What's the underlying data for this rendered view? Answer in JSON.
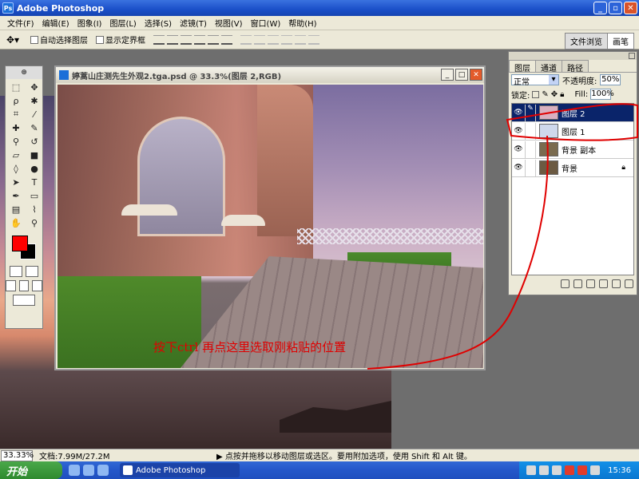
{
  "app": {
    "title": "Adobe Photoshop"
  },
  "menu": [
    "文件(F)",
    "编辑(E)",
    "图象(I)",
    "图层(L)",
    "选择(S)",
    "滤镜(T)",
    "视图(V)",
    "窗口(W)",
    "帮助(H)"
  ],
  "options": {
    "auto_select": "自动选择图层",
    "show_bounds": "显示定界框",
    "tab_file_browser": "文件浏览",
    "tab_brushes": "画笔"
  },
  "document": {
    "title": "婷蒿山庄测先生外观2.tga.psd @ 33.3%(图层 2,RGB)",
    "annotation": "按下ctrl 再点这里选取刚粘贴的位置"
  },
  "layers_panel": {
    "tabs": [
      "图层",
      "通道",
      "路径"
    ],
    "blend_mode": "正常",
    "opacity_label": "不透明度:",
    "opacity_value": "50%",
    "lock_label": "锁定:",
    "fill_label": "Fill:",
    "fill_value": "100%",
    "layers": [
      {
        "name": "图层 2",
        "active": true,
        "thumb": "#d9b0c0"
      },
      {
        "name": "图层 1",
        "active": false,
        "thumb": "#cfd8ec"
      },
      {
        "name": "背景 副本",
        "active": false,
        "thumb": "#7a6b4f"
      },
      {
        "name": "背景",
        "active": false,
        "thumb": "#6b5a42"
      }
    ]
  },
  "status": {
    "zoom": "33.33%",
    "doc": "文档:7.99M/27.2M",
    "hint": "▶ 点按并拖移以移动图层或选区。要用附加选项，使用 Shift 和 Alt 键。"
  },
  "taskbar": {
    "start": "开始",
    "task": "Adobe Photoshop",
    "clock": "15:36"
  },
  "colors": {
    "foreground": "#ff0000",
    "background": "#000000",
    "annotation": "#e00000"
  }
}
